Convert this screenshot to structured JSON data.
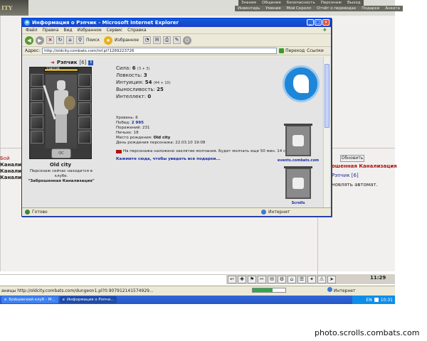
{
  "game": {
    "logo": "ITY",
    "nav_top": [
      "Знания",
      "Общение",
      "Безопасность",
      "Персонаж",
      "Выход"
    ],
    "nav_bottom": [
      "Инвентарь",
      "Умения",
      "Мой Скролл",
      "Отчёт о переводах",
      "Подарки",
      "Анкета"
    ],
    "left_fight": "Бой",
    "left_lines": [
      "Канализация",
      "Канализация",
      "Канализация"
    ],
    "right_location": "ошенная Канализация",
    "right_player": "Рэпчик [6]",
    "right_text": "новлять автомат.",
    "refresh_label": "Обновить",
    "clock": "11:29",
    "toolbar_icons": [
      "↩",
      "✚",
      "⚑",
      "✂",
      "✉",
      "⚙",
      "⌂",
      "☰",
      "✦",
      "⚠",
      "➤"
    ]
  },
  "main_status": {
    "url_text": "аницы http://oldcity.combats.com/dungeon1.pl?0.907912141574929...",
    "zone": "Интернет",
    "progress_pct": 60
  },
  "taskbar": {
    "items": [
      {
        "label": "Бойцовский клуб - M...",
        "active": false
      },
      {
        "label": "Информация о Рэпчи...",
        "active": true
      }
    ],
    "tray_lang": "EN",
    "tray_time": "10:31"
  },
  "popup": {
    "title": "Информация о Рэпчик - Microsoft Internet Explorer",
    "menu": [
      "Файл",
      "Правка",
      "Вид",
      "Избранное",
      "Сервис",
      "Справка"
    ],
    "toolbar": {
      "search": "Поиск",
      "favorites": "Избранное"
    },
    "address_label": "Адрес:",
    "address": "http://oldcity.combats.com/inf.pl?1269223726",
    "go_label": "Переход",
    "links_label": "Ссылки",
    "status_ready": "Готово",
    "status_zone": "Интернет"
  },
  "character": {
    "name": "Рэпчик",
    "level": "[6]",
    "hp": "238/238",
    "hp_pct": 100,
    "emblem": "OC",
    "city": "Old city",
    "club_line1": "Персонаж сейчас находится в клубе.",
    "club_line2": "\"Заброшенная Канализация\"",
    "stats": [
      {
        "label": "Сила:",
        "value": "6",
        "extra": "(3 + 3)"
      },
      {
        "label": "Ловкость:",
        "value": "3",
        "extra": ""
      },
      {
        "label": "Интуиция:",
        "value": "54",
        "extra": "(44 + 10)"
      },
      {
        "label": "Выносливость:",
        "value": "25",
        "extra": ""
      },
      {
        "label": "Интеллект:",
        "value": "0",
        "extra": ""
      }
    ],
    "info": {
      "level_line": "Уровень: 6",
      "wins_label": "Побед:",
      "wins": "2 995",
      "losses": "Поражений: 231",
      "draws": "Ничьих: 18",
      "birthplace_label": "Место рождения:",
      "birthplace": "Old city",
      "birthday": "День рождения персонажа: 22.03.10 19:08"
    },
    "silence_text": "На персонажа наложено заклятие молчания. Будет молчать еще 50 мин. 14 сек.",
    "gift_link": "Кажмите сюда, чтобы увидеть все подарки...",
    "badges": {
      "site_label": "events.combats.com",
      "scrolls_label": "Scrolls"
    }
  },
  "watermark": "photo.scrolls.combats.com",
  "colors": {
    "xp_blue": "#0a5fd9",
    "link_blue": "#1a2aa0",
    "alert_red": "#b01010",
    "badge_blue": "#1e86d8"
  }
}
